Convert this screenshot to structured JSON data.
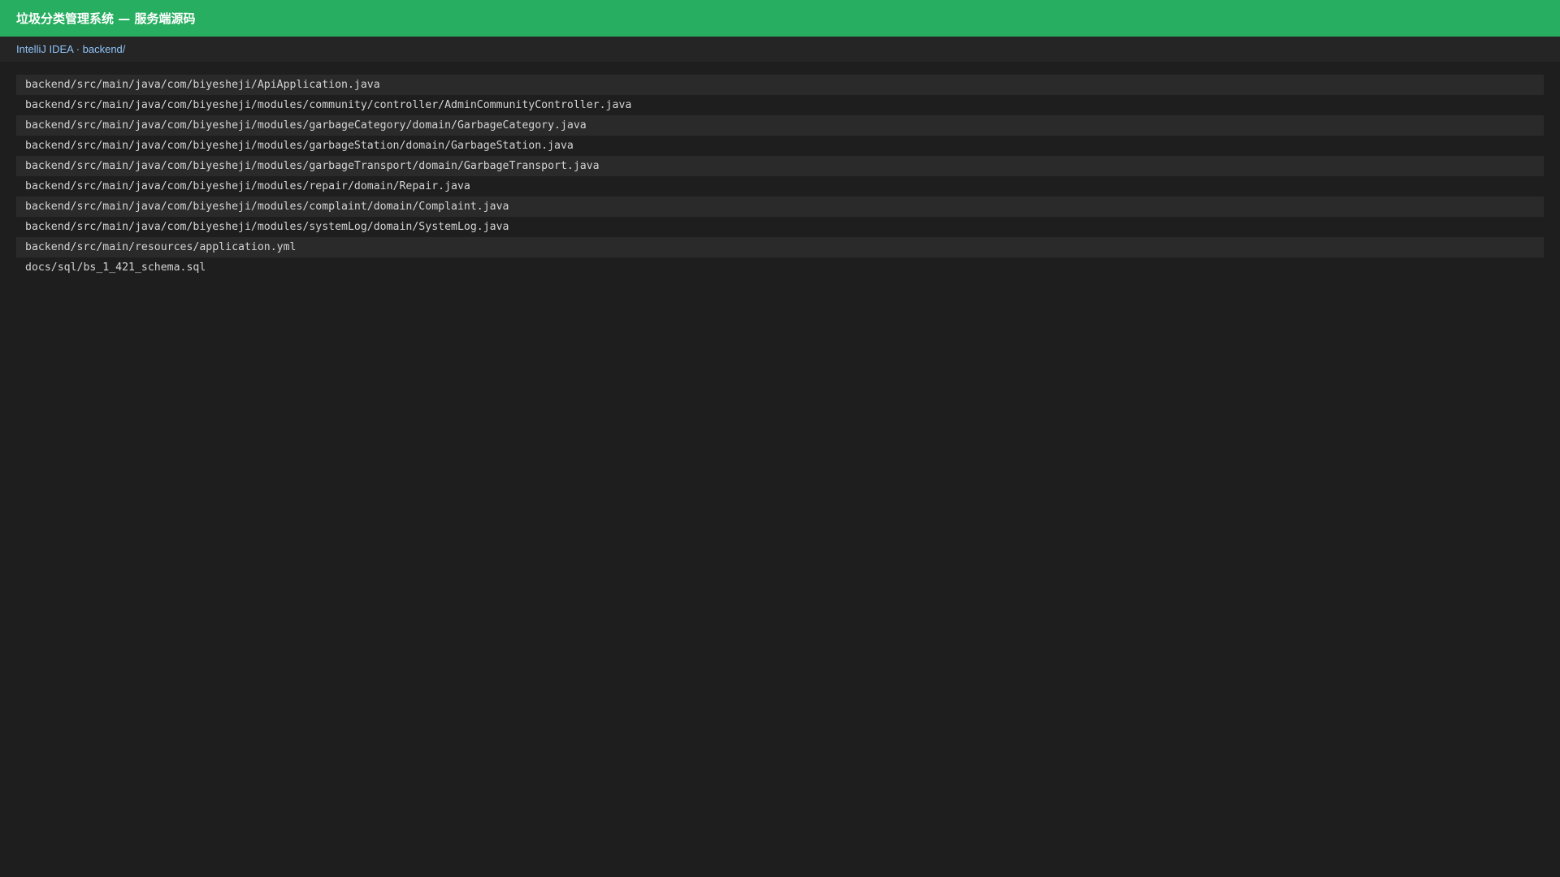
{
  "header": {
    "title": "垃圾分类管理系统 — 服务端源码"
  },
  "breadcrumb": {
    "text": "IntelliJ IDEA · backend/"
  },
  "files": [
    "backend/src/main/java/com/biyesheji/ApiApplication.java",
    "backend/src/main/java/com/biyesheji/modules/community/controller/AdminCommunityController.java",
    "backend/src/main/java/com/biyesheji/modules/garbageCategory/domain/GarbageCategory.java",
    "backend/src/main/java/com/biyesheji/modules/garbageStation/domain/GarbageStation.java",
    "backend/src/main/java/com/biyesheji/modules/garbageTransport/domain/GarbageTransport.java",
    "backend/src/main/java/com/biyesheji/modules/repair/domain/Repair.java",
    "backend/src/main/java/com/biyesheji/modules/complaint/domain/Complaint.java",
    "backend/src/main/java/com/biyesheji/modules/systemLog/domain/SystemLog.java",
    "backend/src/main/resources/application.yml",
    "docs/sql/bs_1_421_schema.sql"
  ],
  "colors": {
    "header_bg": "#27ae60",
    "page_bg": "#1e1e1e",
    "breadcrumb_text": "#8fc3f7"
  }
}
